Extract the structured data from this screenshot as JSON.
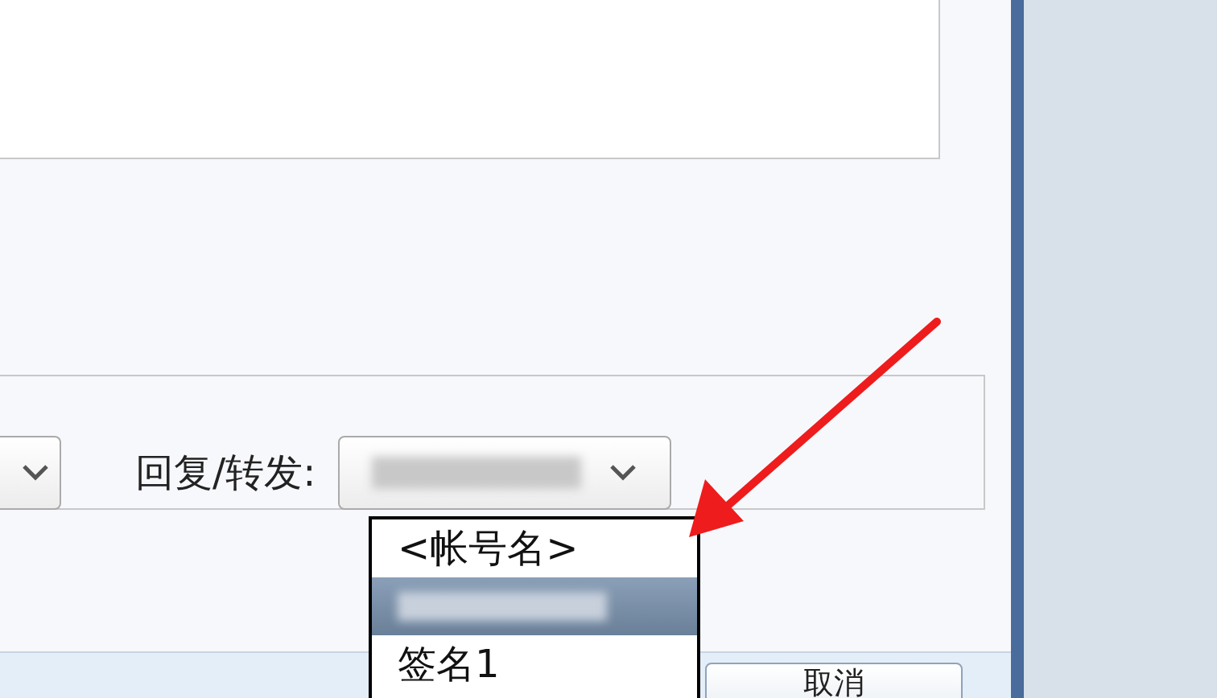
{
  "reply_forward": {
    "label": "回复/转发:",
    "list": [
      {
        "kind": "text",
        "label": "<帐号名>",
        "selected": false
      },
      {
        "kind": "redacted",
        "selected": true
      },
      {
        "kind": "text",
        "label": "签名1",
        "selected": false
      }
    ]
  },
  "buttons": [
    {
      "label": "取消"
    }
  ]
}
